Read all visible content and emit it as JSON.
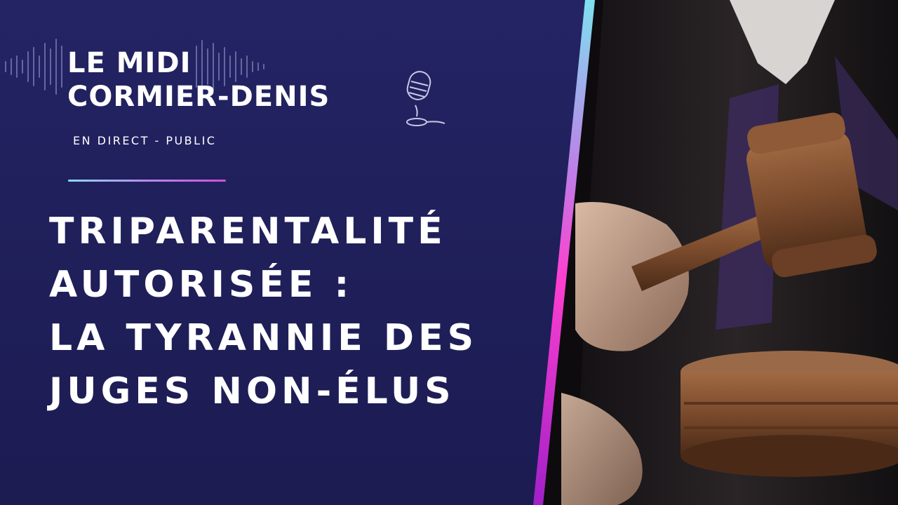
{
  "show": {
    "title_line1": "LE MIDI",
    "title_line2": "CORMIER-DENIS",
    "subtitle": "EN DIRECT - PUBLIC"
  },
  "headline": {
    "line1": "TRIPARENTALITÉ",
    "line2": "AUTORISÉE :",
    "line3": "LA TYRANNIE DES",
    "line4": "JUGES NON-ÉLUS"
  },
  "icons": {
    "waveform": "sound-wave-icon",
    "microphone": "microphone-icon"
  },
  "colors": {
    "panel": "#20205c",
    "text": "#ffffff",
    "edge_gradient": [
      "#7fe0f0",
      "#c07be6",
      "#ff3fcf",
      "#a020c8"
    ],
    "gavel": "#7a4a2c"
  }
}
